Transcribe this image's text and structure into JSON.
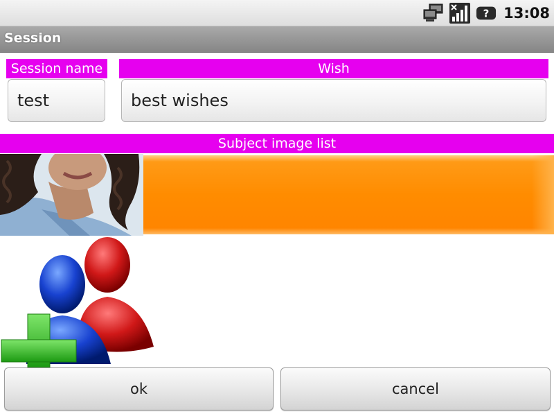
{
  "status_bar": {
    "time": "13:08",
    "icons": [
      "network-icon",
      "signal-icon",
      "help-icon"
    ],
    "help_glyph": "?"
  },
  "titlebar": {
    "title": "Session"
  },
  "form": {
    "session_name_label": "Session name",
    "session_name_value": "test",
    "wish_label": "Wish",
    "wish_value": "best wishes",
    "subject_image_list_label": "Subject image list"
  },
  "colors": {
    "label_bg": "#e600ef",
    "strip_accent": "#ff8c00"
  },
  "buttons": {
    "ok_label": "ok",
    "cancel_label": "cancel"
  }
}
